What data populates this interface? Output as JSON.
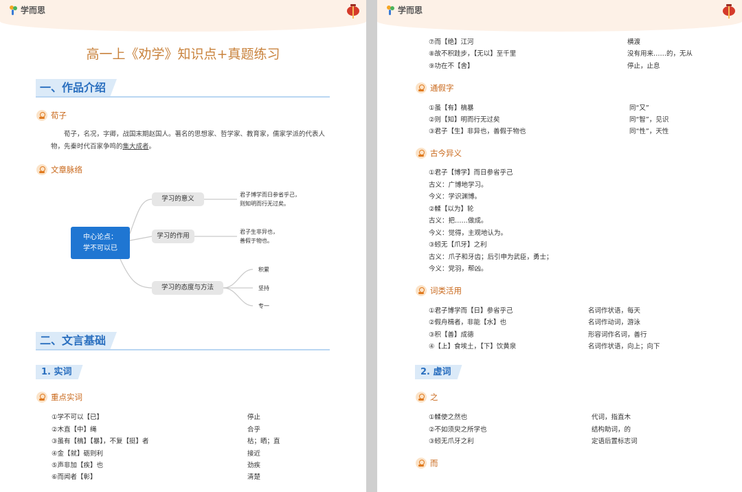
{
  "brand": {
    "name": "学而思"
  },
  "left": {
    "title": "高一上《劝学》知识点+真题练习",
    "section1": {
      "label": "一、作品介绍"
    },
    "author": {
      "label": "荀子",
      "text_before": "荀子，名况，字卿，战国末期赵国人。著名的思想家、哲学家、教育家，儒家学派的代表人物，先秦时代百家争鸣的",
      "text_underlined": "集大成者",
      "text_after": "。"
    },
    "structure": {
      "label": "文章脉络",
      "root_line1": "中心论点：",
      "root_line2": "学不可以已",
      "branches": [
        {
          "label": "学习的意义",
          "leaf_line1": "君子博学而日参省乎己，",
          "leaf_line2": "则知明而行无过矣。"
        },
        {
          "label": "学习的作用",
          "leaf_line1": "君子生非异也，",
          "leaf_line2": "善假于物也。"
        },
        {
          "label": "学习的态度与方法",
          "leaves": [
            "积累",
            "坚持",
            "专一"
          ]
        }
      ]
    },
    "section2": {
      "label": "二、文言基础"
    },
    "sub1": {
      "label": "1. 实词"
    },
    "key_words": {
      "label": "重点实词",
      "rows": [
        {
          "term": "①学不可以【已】",
          "meaning": "停止"
        },
        {
          "term": "②木直【中】绳",
          "meaning": "合乎"
        },
        {
          "term": "③虽有【槁】【暴】，不复【挺】者",
          "meaning": "枯；晒；直"
        },
        {
          "term": "④金【就】砺则利",
          "meaning": "接近"
        },
        {
          "term": "⑤声非加【疾】也",
          "meaning": "劲疾"
        },
        {
          "term": "⑥而闻者【彰】",
          "meaning": "清楚"
        }
      ]
    }
  },
  "right": {
    "continued_rows": [
      {
        "term": "⑦而【绝】江河",
        "meaning": "横渡"
      },
      {
        "term": "⑧故不积跬步，【无以】至千里",
        "meaning": "没有用来……的，无从"
      },
      {
        "term": "⑨功在不【舍】",
        "meaning": "停止，止息"
      }
    ],
    "tongjia": {
      "label": "通假字",
      "rows": [
        {
          "term": "①虽【有】槁暴",
          "meaning": "同“又”"
        },
        {
          "term": "②则【知】明而行无过矣",
          "meaning": "同“智”，见识"
        },
        {
          "term": "③君子【生】非异也，善假于物也",
          "meaning": "同“性”，天性"
        }
      ]
    },
    "gujin": {
      "label": "古今异义",
      "lines": [
        "①君子【博学】而日参省乎己",
        "古义：广博地学习。",
        "今义：学识渊博。",
        "②輮【以为】轮",
        "古义：把……做成。",
        "今义：觉得，主观地认为。",
        "③蚓无【爪牙】之利",
        "古义：爪子和牙齿；后引申为武臣，勇士；",
        "今义：党羽，帮凶。"
      ]
    },
    "cilei": {
      "label": "词类活用",
      "rows": [
        {
          "term": "①君子博学而【日】参省乎己",
          "meaning": "名词作状语，每天"
        },
        {
          "term": "②假舟楫者，非能【水】也",
          "meaning": "名词作动词，游泳"
        },
        {
          "term": "③积【善】成德",
          "meaning": "形容词作名词，善行"
        },
        {
          "term": "④【上】食埃土，【下】饮黄泉",
          "meaning": "名词作状语，向上；向下"
        }
      ]
    },
    "sub2": {
      "label": "2. 虚词"
    },
    "zhi": {
      "label": "之",
      "rows": [
        {
          "term": "①輮使之然也",
          "meaning": "代词，指直木"
        },
        {
          "term": "②不如须臾之所学也",
          "meaning": "结构助词，的"
        },
        {
          "term": "③蚓无爪牙之利",
          "meaning": "定语后置标志词"
        }
      ]
    },
    "er": {
      "label": "而"
    }
  }
}
